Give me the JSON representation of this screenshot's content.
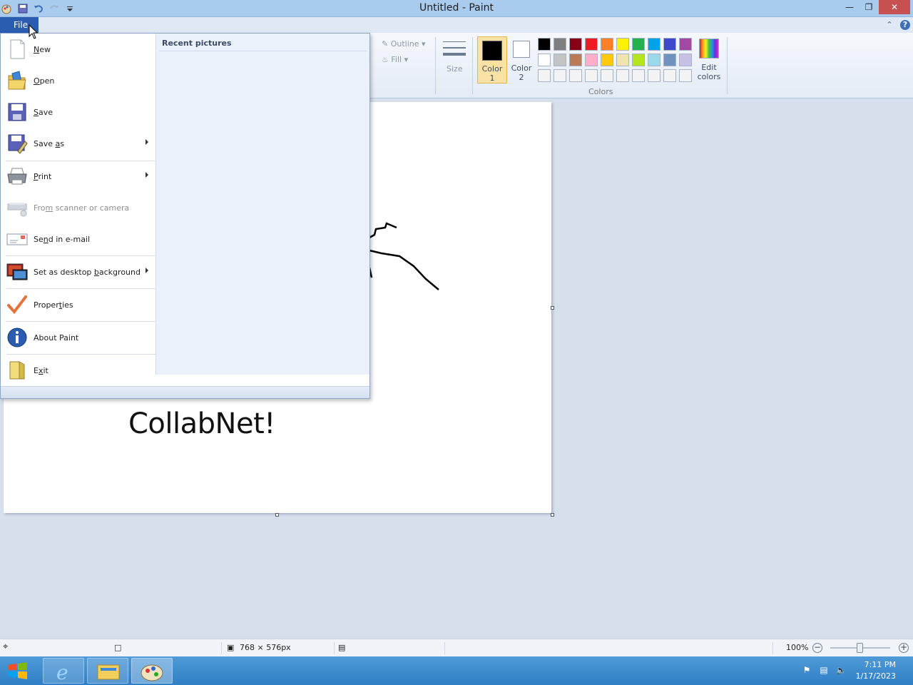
{
  "window": {
    "title": "Untitled - Paint"
  },
  "ribbon": {
    "file_tab": "File",
    "outline_label": "Outline",
    "fill_label": "Fill",
    "size_label": "Size",
    "color1_label_line1": "Color",
    "color1_label_line2": "1",
    "color2_label_line1": "Color",
    "color2_label_line2": "2",
    "colors_group_label": "Colors",
    "edit_colors_line1": "Edit",
    "edit_colors_line2": "colors",
    "color1": "#000000",
    "color2": "#ffffff",
    "palette_row1": [
      "#000000",
      "#7f7f7f",
      "#880015",
      "#ed1c24",
      "#ff7f27",
      "#fff200",
      "#22b14c",
      "#00a2e8",
      "#3f48cc",
      "#a349a4"
    ],
    "palette_row2": [
      "#ffffff",
      "#c3c3c3",
      "#b97a57",
      "#ffaec9",
      "#ffc90e",
      "#efe4b0",
      "#b5e61d",
      "#99d9ea",
      "#7092be",
      "#c8bfe7"
    ],
    "palette_row3": [
      "#f3f3f3",
      "#f3f3f3",
      "#f3f3f3",
      "#f3f3f3",
      "#f3f3f3",
      "#f3f3f3",
      "#f3f3f3",
      "#f3f3f3",
      "#f3f3f3",
      "#f3f3f3"
    ]
  },
  "file_menu": {
    "recent_title": "Recent pictures",
    "items": [
      {
        "label": "New",
        "icon": "new-file-icon",
        "submenu": false,
        "enabled": true
      },
      {
        "label": "Open",
        "icon": "open-folder-icon",
        "submenu": false,
        "enabled": true
      },
      {
        "label": "Save",
        "icon": "save-disk-icon",
        "submenu": false,
        "enabled": true
      },
      {
        "label": "Save as",
        "icon": "save-as-icon",
        "submenu": true,
        "enabled": true
      },
      {
        "label": "Print",
        "icon": "printer-icon",
        "submenu": true,
        "enabled": true
      },
      {
        "label": "From scanner or camera",
        "icon": "scanner-icon",
        "submenu": false,
        "enabled": false
      },
      {
        "label": "Send in e-mail",
        "icon": "email-icon",
        "submenu": false,
        "enabled": true
      },
      {
        "label": "Set as desktop background",
        "icon": "desktop-background-icon",
        "submenu": true,
        "enabled": true
      },
      {
        "label": "Properties",
        "icon": "checkmark-icon",
        "submenu": false,
        "enabled": true
      },
      {
        "label": "About Paint",
        "icon": "info-icon",
        "submenu": false,
        "enabled": true
      },
      {
        "label": "Exit",
        "icon": "exit-icon",
        "submenu": false,
        "enabled": true
      }
    ]
  },
  "canvas": {
    "text": "CollabNet!"
  },
  "statusbar": {
    "dimensions": "768 × 576px",
    "zoom": "100%"
  },
  "taskbar": {
    "time": "7:11 PM",
    "date": "1/17/2023"
  }
}
